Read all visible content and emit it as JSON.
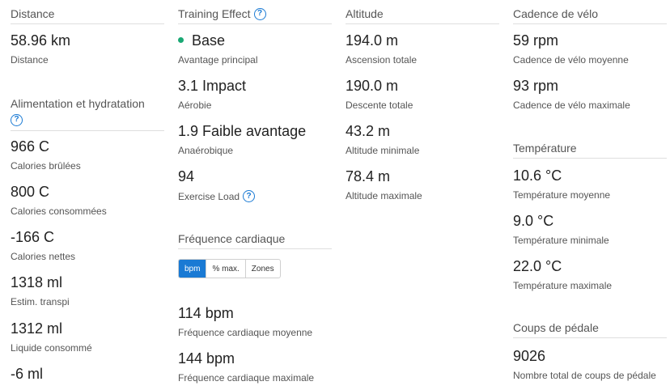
{
  "distance": {
    "title": "Distance",
    "items": [
      {
        "value": "58.96 km",
        "label": "Distance"
      }
    ]
  },
  "nutrition": {
    "title": "Alimentation et hydratation",
    "items": [
      {
        "value": "966 C",
        "label": "Calories brûlées"
      },
      {
        "value": "800 C",
        "label": "Calories consommées"
      },
      {
        "value": "-166 C",
        "label": "Calories nettes"
      },
      {
        "value": "1318 ml",
        "label": "Estim. transpi"
      },
      {
        "value": "1312 ml",
        "label": "Liquide consommé"
      },
      {
        "value": "-6 ml",
        "label": ""
      }
    ]
  },
  "training_effect": {
    "title": "Training Effect",
    "items": [
      {
        "value": "Base",
        "label": "Avantage principal"
      },
      {
        "value": "3.1 Impact",
        "label": "Aérobie"
      },
      {
        "value": "1.9 Faible avantage",
        "label": "Anaérobique"
      },
      {
        "value": "94",
        "label": "Exercise Load"
      }
    ],
    "dot_color": "#1aa874"
  },
  "heart_rate": {
    "title": "Fréquence cardiaque",
    "tabs": [
      "bpm",
      "% max.",
      "Zones"
    ],
    "active_tab": "bpm",
    "items": [
      {
        "value": "114 bpm",
        "label": "Fréquence cardiaque moyenne"
      },
      {
        "value": "144 bpm",
        "label": "Fréquence cardiaque maximale"
      }
    ]
  },
  "altitude": {
    "title": "Altitude",
    "items": [
      {
        "value": "194.0 m",
        "label": "Ascension totale"
      },
      {
        "value": "190.0 m",
        "label": "Descente totale"
      },
      {
        "value": "43.2 m",
        "label": "Altitude minimale"
      },
      {
        "value": "78.4 m",
        "label": "Altitude maximale"
      }
    ]
  },
  "cadence": {
    "title": "Cadence de vélo",
    "items": [
      {
        "value": "59 rpm",
        "label": "Cadence de vélo moyenne"
      },
      {
        "value": "93 rpm",
        "label": "Cadence de vélo maximale"
      }
    ]
  },
  "temperature": {
    "title": "Température",
    "items": [
      {
        "value": "10.6 °C",
        "label": "Température moyenne"
      },
      {
        "value": "9.0 °C",
        "label": "Température minimale"
      },
      {
        "value": "22.0 °C",
        "label": "Température maximale"
      }
    ]
  },
  "strokes": {
    "title": "Coups de pédale",
    "items": [
      {
        "value": "9026",
        "label": "Nombre total de coups de pédale"
      }
    ]
  },
  "help_glyph": "?",
  "accent_color": "#1a7ad4"
}
